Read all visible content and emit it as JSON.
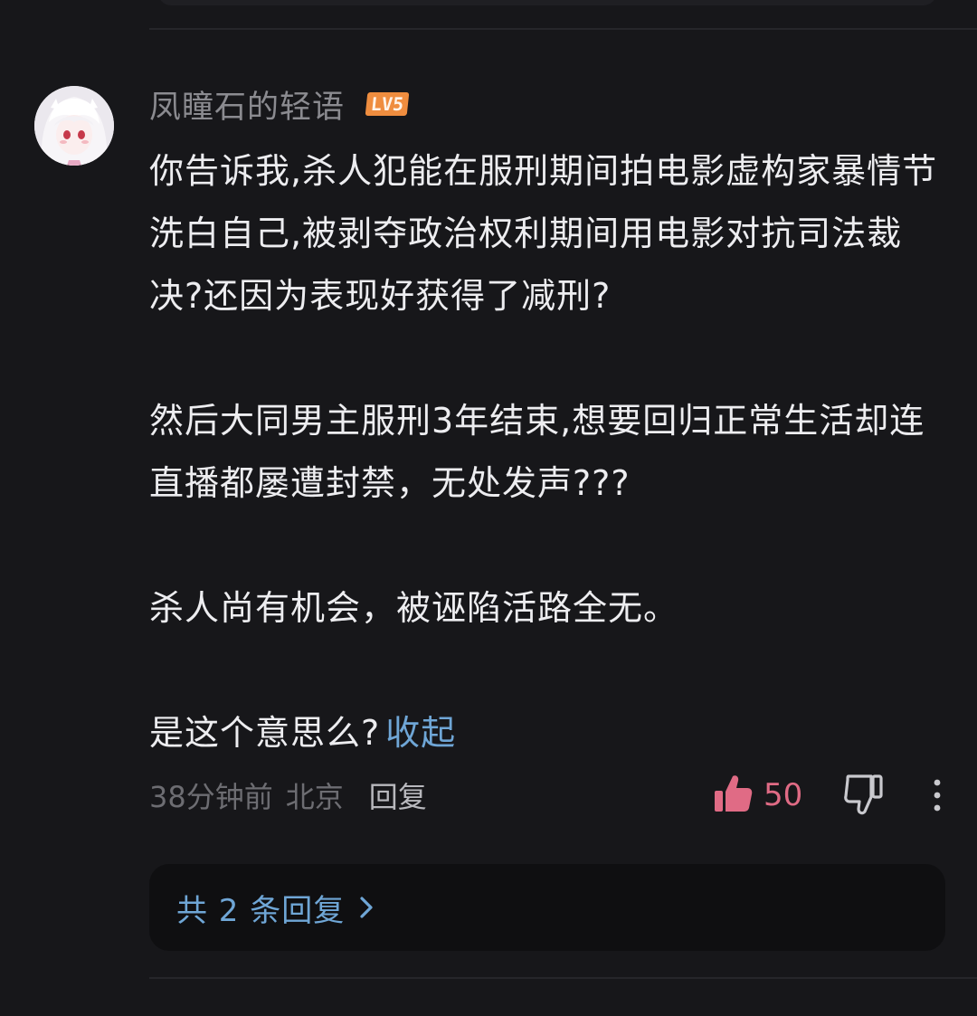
{
  "comment": {
    "username": "凤瞳石的轻语",
    "level_badge": "LV5",
    "paragraphs": [
      "你告诉我,杀人犯能在服刑期间拍电影虚构家暴情节洗白自己,被剥夺政治权利期间用电影对抗司法裁决?还因为表现好获得了减刑?",
      "然后大同男主服刑3年结束,想要回归正常生活却连直播都屡遭封禁，无处发声???",
      "杀人尚有机会，被诬陷活路全无。",
      "是这个意思么?"
    ],
    "collapse_label": "收起",
    "time": "38分钟前",
    "location": "北京",
    "reply_label": "回复",
    "like_count": "50",
    "replies_summary": "共 2 条回复"
  },
  "icons": {
    "like": "thumbs-up-icon",
    "dislike": "thumbs-down-icon",
    "more": "more-vertical-icon",
    "chevron": "chevron-right-icon"
  },
  "colors": {
    "background": "#17171a",
    "link": "#6fa6d6",
    "like": "#e06b85",
    "level_badge": "#ef8d3f"
  }
}
